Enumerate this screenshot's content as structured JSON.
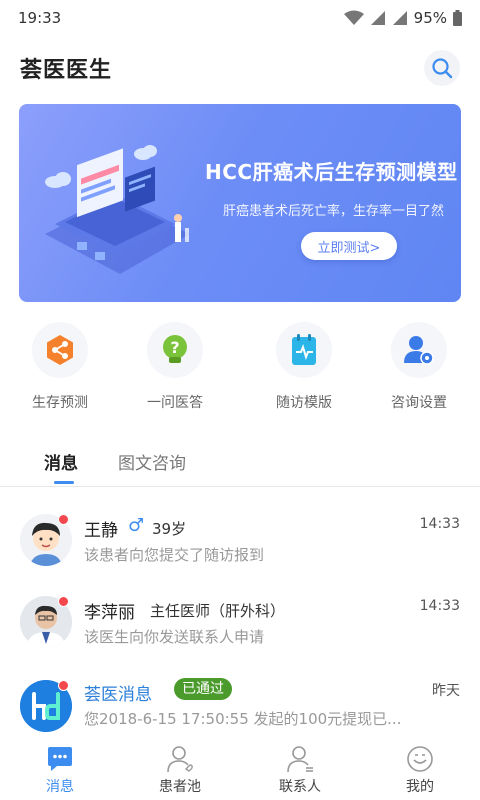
{
  "status_bar": {
    "time": "19:33",
    "battery": "95%"
  },
  "header": {
    "title": "荟医医生"
  },
  "banner": {
    "title": "HCC肝癌术后生存预测模型",
    "subtitle": "肝癌患者术后死亡率，生存率一目了然",
    "button_label": "立即测试>"
  },
  "shortcuts": [
    {
      "label": "生存预测",
      "icon": "share-nodes-icon"
    },
    {
      "label": "一问医答",
      "icon": "question-bulb-icon"
    },
    {
      "label": "随访模版",
      "icon": "clipboard-pulse-icon"
    },
    {
      "label": "咨询设置",
      "icon": "user-gear-icon"
    }
  ],
  "tabs": [
    {
      "label": "消息",
      "active": true
    },
    {
      "label": "图文咨询",
      "active": false
    }
  ],
  "messages": [
    {
      "name": "王静",
      "gender": "♂",
      "meta": "39岁",
      "time": "14:33",
      "preview": "该患者向您提交了随访报到"
    },
    {
      "name": "李萍丽",
      "gender": "",
      "meta": "主任医师（肝外科）",
      "time": "14:33",
      "preview": "该医生向你发送联系人申请"
    },
    {
      "name": "荟医消息",
      "gender": "",
      "badge": "已通过",
      "time": "昨天",
      "preview": "您2018-6-15  17:50:55 发起的100元提现已..."
    }
  ],
  "bottom_nav": [
    {
      "label": "消息",
      "icon": "chat-icon",
      "active": true
    },
    {
      "label": "患者池",
      "icon": "patient-icon",
      "active": false
    },
    {
      "label": "联系人",
      "icon": "contacts-icon",
      "active": false
    },
    {
      "label": "我的",
      "icon": "profile-icon",
      "active": false
    }
  ],
  "colors": {
    "accent": "#3d8cf0",
    "banner": "#6d8df6",
    "badge_green": "#4b9a2c",
    "unread_dot": "#f2484e"
  }
}
